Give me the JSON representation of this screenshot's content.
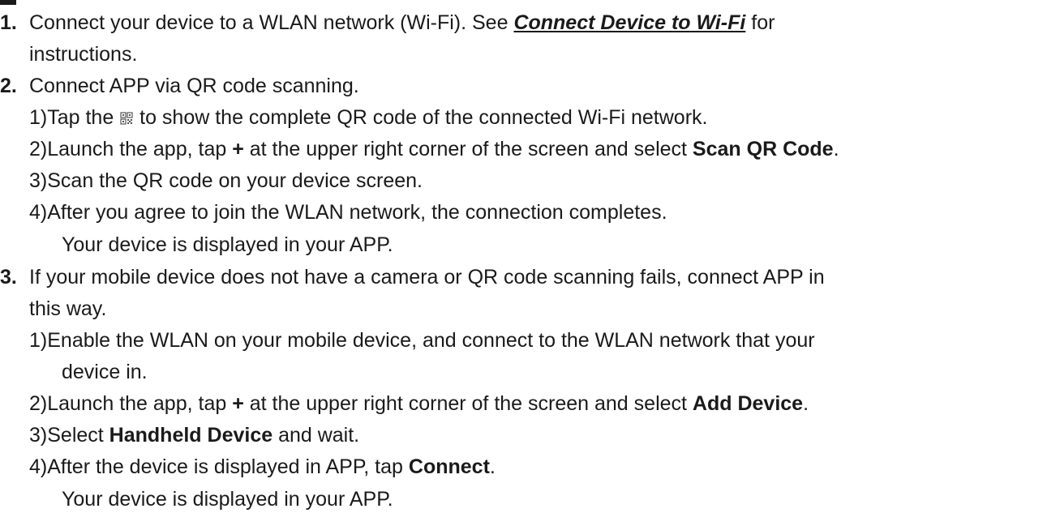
{
  "steps": [
    {
      "num": "1.",
      "pre": "Connect your device to a WLAN network (Wi-Fi). See ",
      "link": "Connect Device to Wi-Fi",
      "post": " for",
      "cont": "instructions."
    },
    {
      "num": "2.",
      "text": "Connect APP via QR code scanning.",
      "substeps": [
        {
          "num": "1)",
          "pre": "Tap the ",
          "icon": "qr-code-icon",
          "post": " to show the complete QR code of the connected Wi-Fi network."
        },
        {
          "num": "2)",
          "pre": "Launch the app, tap ",
          "plus": "+",
          "mid": " at the upper right corner of the screen and select ",
          "bold": "Scan QR Code",
          "post": "."
        },
        {
          "num": "3)",
          "text": "Scan the QR code on your device screen."
        },
        {
          "num": "4)",
          "text": "After you agree to join the WLAN network, the connection completes."
        }
      ],
      "result": "Your device is displayed in your APP."
    },
    {
      "num": "3.",
      "text": "If your mobile device does not have a camera or QR code scanning fails, connect APP in",
      "cont": "this way.",
      "substeps": [
        {
          "num": "1)",
          "text": "Enable the WLAN on your mobile device, and connect to the WLAN network that your",
          "cont": "device in."
        },
        {
          "num": "2)",
          "pre": "Launch the app, tap ",
          "plus": "+",
          "mid": " at the upper right corner of the screen and select ",
          "bold": "Add Device",
          "post": "."
        },
        {
          "num": "3)",
          "pre": "Select ",
          "bold": "Handheld Device",
          "post": " and wait."
        },
        {
          "num": "4)",
          "pre": "After the device is displayed in APP, tap ",
          "bold": "Connect",
          "post": "."
        }
      ],
      "result": "Your device is displayed in your APP."
    }
  ]
}
